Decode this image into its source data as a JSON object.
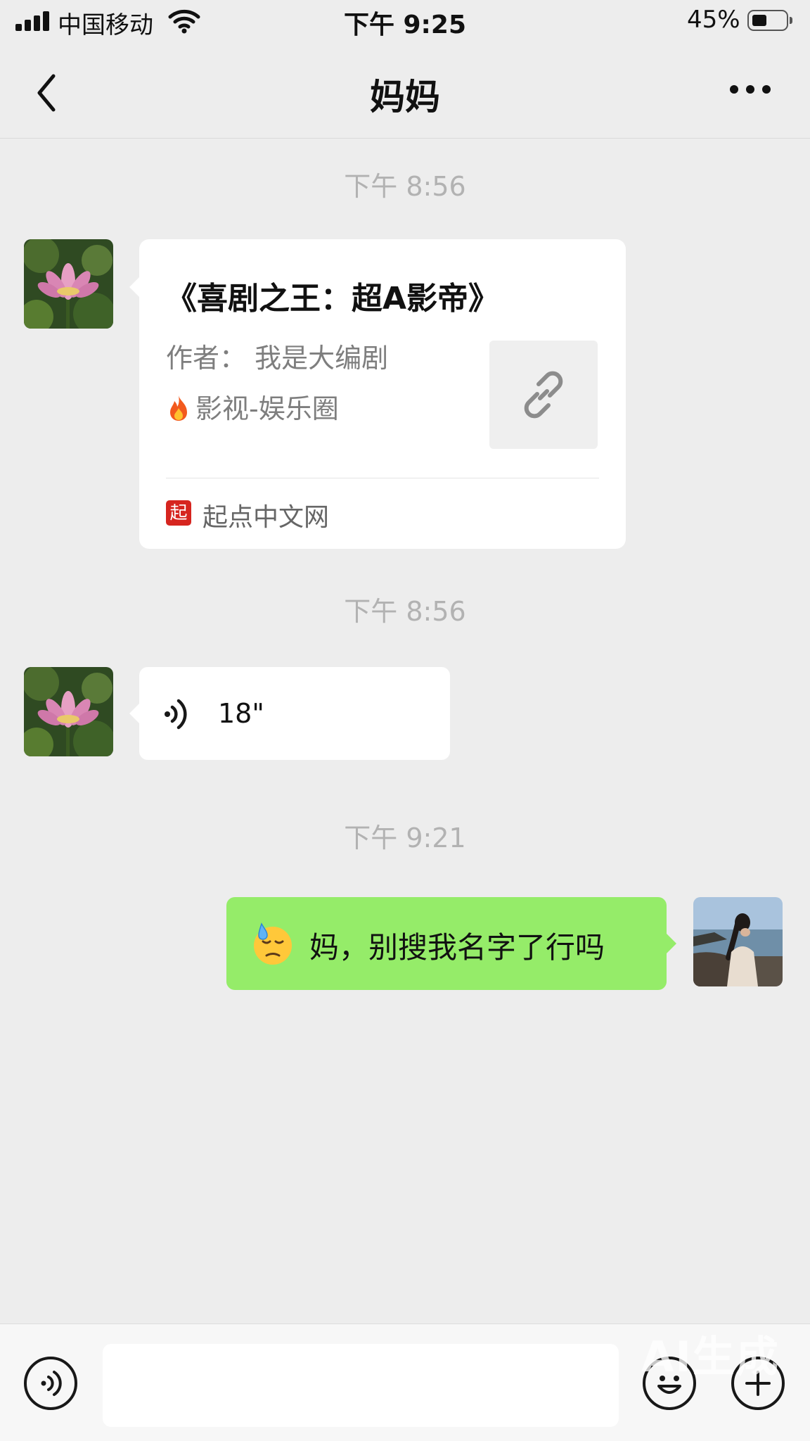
{
  "status_bar": {
    "carrier": "中国移动",
    "time": "下午 9:25",
    "battery_percent": "45%",
    "battery_level": 0.45
  },
  "nav": {
    "title": "妈妈",
    "back_icon": "chevron-left-icon",
    "more_icon": "more-dots-icon"
  },
  "messages": [
    {
      "timestamp": "下午 8:56",
      "type": "link-card",
      "title": "《喜剧之王：超A影帝》",
      "author": "作者：  我是大编剧",
      "tag": "影视-娱乐圈",
      "source_badge": "起",
      "source": "起点中文网"
    },
    {
      "timestamp": "下午 8:56",
      "type": "voice",
      "duration": "18\""
    },
    {
      "timestamp": "下午 9:21",
      "type": "text",
      "text": "妈，别搜我名字了行吗"
    }
  ],
  "input_bar": {
    "placeholder": "",
    "voice_icon": "voice-mode-icon",
    "emoji_icon": "emoji-icon",
    "plus_icon": "plus-icon"
  },
  "watermark": "AI生成",
  "colors": {
    "background": "#ededed",
    "sent_bubble": "#95ec69",
    "received_bubble": "#ffffff",
    "timestamp": "#b2b2b2",
    "source_badge": "#d6251f"
  }
}
